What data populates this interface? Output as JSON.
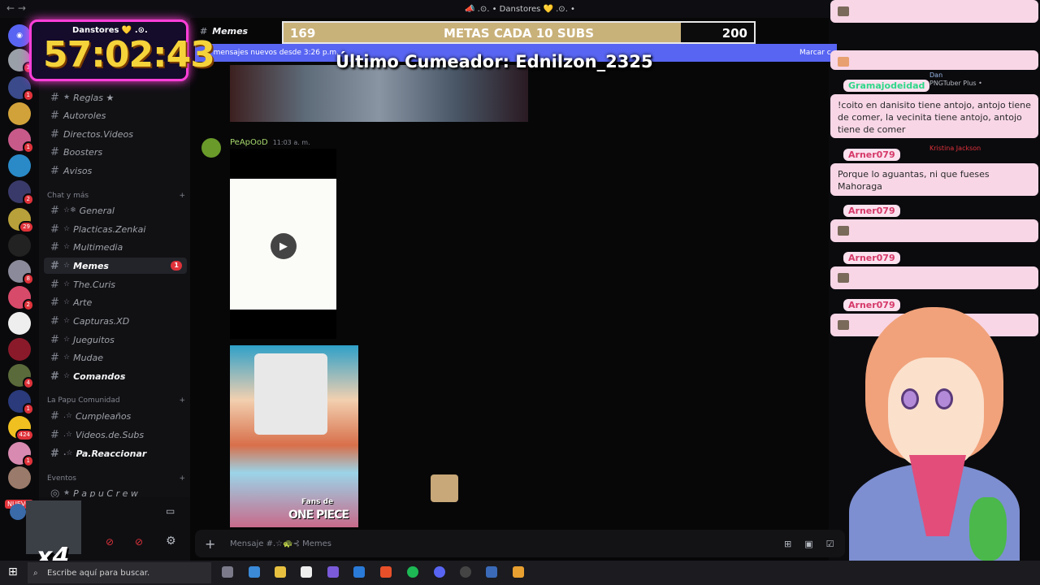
{
  "window": {
    "title": "📣 .⊙. • Danstores 💛 .⊙. •"
  },
  "timer": {
    "value": "57:02:43",
    "subtitle": "Danstores 💛 .⊙."
  },
  "servers": {
    "badges": [
      "3",
      "1",
      "1",
      "2",
      "29",
      "8",
      "2",
      "4",
      "1",
      "424",
      "1"
    ],
    "nuevo": "NUEVO"
  },
  "channels": {
    "items": [
      {
        "label": "Reglas ★",
        "prefix": "★"
      },
      {
        "label": "Autoroles",
        "prefix": ""
      },
      {
        "label": "Directos.Videos",
        "prefix": ""
      },
      {
        "label": "Boosters",
        "prefix": ""
      },
      {
        "label": "Avisos",
        "prefix": ""
      },
      {
        "label": "General",
        "prefix": "☆❄"
      },
      {
        "label": "Placticas.Zenkai",
        "prefix": "☆"
      },
      {
        "label": "Multimedia",
        "prefix": "☆"
      },
      {
        "label": "Memes",
        "prefix": "☆"
      },
      {
        "label": "The.Curis",
        "prefix": "☆"
      },
      {
        "label": "Arte",
        "prefix": "☆"
      },
      {
        "label": "Capturas.XD",
        "prefix": "☆"
      },
      {
        "label": "Jueguitos",
        "prefix": "☆"
      },
      {
        "label": "Mudae",
        "prefix": "☆"
      },
      {
        "label": "Comandos",
        "prefix": "☆"
      },
      {
        "label": "Cumpleaños",
        "prefix": ".☆"
      },
      {
        "label": "Videos.de.Subs",
        "prefix": ".☆"
      },
      {
        "label": "Pa.Reaccionar",
        "prefix": ".☆"
      },
      {
        "label": "P a p u  C r e w",
        "prefix": "★"
      }
    ],
    "categories": [
      "Chat y más",
      "La Papu Comunidad",
      "Eventos"
    ],
    "memes_unread": "1"
  },
  "header": {
    "channel": "Memes"
  },
  "newbar": {
    "text": "6 mensajes nuevos desde 3:26 p.m.",
    "mark": "Marcar c"
  },
  "goal": {
    "low": "169",
    "label": "METAS CADA 10 SUBS",
    "high": "200",
    "progress": 0.845
  },
  "last_cum": "Último Cumeador: Ednilzon_2325",
  "message": {
    "author": "PeApOoD",
    "time": "11:03 a. m.",
    "meme_caption": "Fans de",
    "meme_title": "ONE PIECE"
  },
  "composer": {
    "placeholder": "Mensaje #.☆🐢⊰ Memes"
  },
  "taskbar": {
    "search": "Escribe aquí para buscar."
  },
  "overlay": {
    "x4": "x4"
  },
  "chat": [
    {
      "user": "Gramajodeidad",
      "text": "!coito en danisito tiene antojo, antojo tiene de comer, la vecinita tiene antojo, antojo tiene de comer"
    },
    {
      "user": "Arner079",
      "text": "Porque lo aguantas, ni que fueses Mahoraga"
    },
    {
      "user": "Arner079",
      "text": ""
    },
    {
      "user": "Arner079",
      "text": ""
    },
    {
      "user": "Arner079",
      "text": ""
    }
  ],
  "background_chat": {
    "dan": "Dan",
    "png": "PNGTuber Plus •",
    "kristina": "Kristina Jackson"
  }
}
